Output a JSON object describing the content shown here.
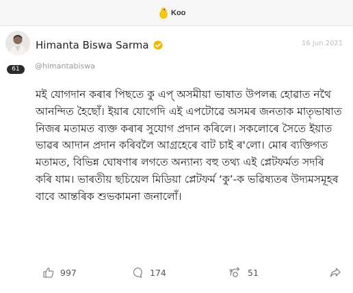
{
  "app": {
    "brand_label": "Koo",
    "brand_color": "#f5c518"
  },
  "post": {
    "author_name": "Himanta Biswa Sarma",
    "handle": "@himantabiswa",
    "verified_color": "#f5b800",
    "date": "16 Jun 2021",
    "follower_badge": "61",
    "body": "মই যোগদান কৰাৰ পিছতে কু এপ্ অসমীয়া ভাষাত উপলব্ধ হোৱাত নথৈ আনন্দিত হৈছোঁ। ইয়াৰ যোগেদি এই এপটোৱে অসমৰ জনতাক মাতৃভাষাত নিজৰ মতামত ব্যক্ত কৰাৰ সুযোগ প্ৰদান কৰিলে। সকলোৰে সৈতে ইয়াত ভাৱৰ আদান প্ৰদান কৰিবলৈ আগ্ৰহেৰে বাট চাই ৰ'লো। মোৰ ব্যক্তিগত মতামত, বিভিন্ন ঘোষণাৰ লগতে অন্যান্য বহু তথ্য এই প্লেটফৰ্মত সদৰি কৰি যাম। ভাৰতীয় ছচিয়েল মিডিয়া প্লেটফৰ্ম ‘কু’-ক ভৱিষ্যতৰ উদ্যমসমূহৰ বাবে আন্তৰিক শুভকামনা জনালোঁ।"
  },
  "actions": {
    "likes": "997",
    "comments": "174",
    "rekoos": "51",
    "icons": [
      "thumbs-up-icon",
      "comment-icon",
      "rekoo-icon",
      "share-icon"
    ]
  }
}
